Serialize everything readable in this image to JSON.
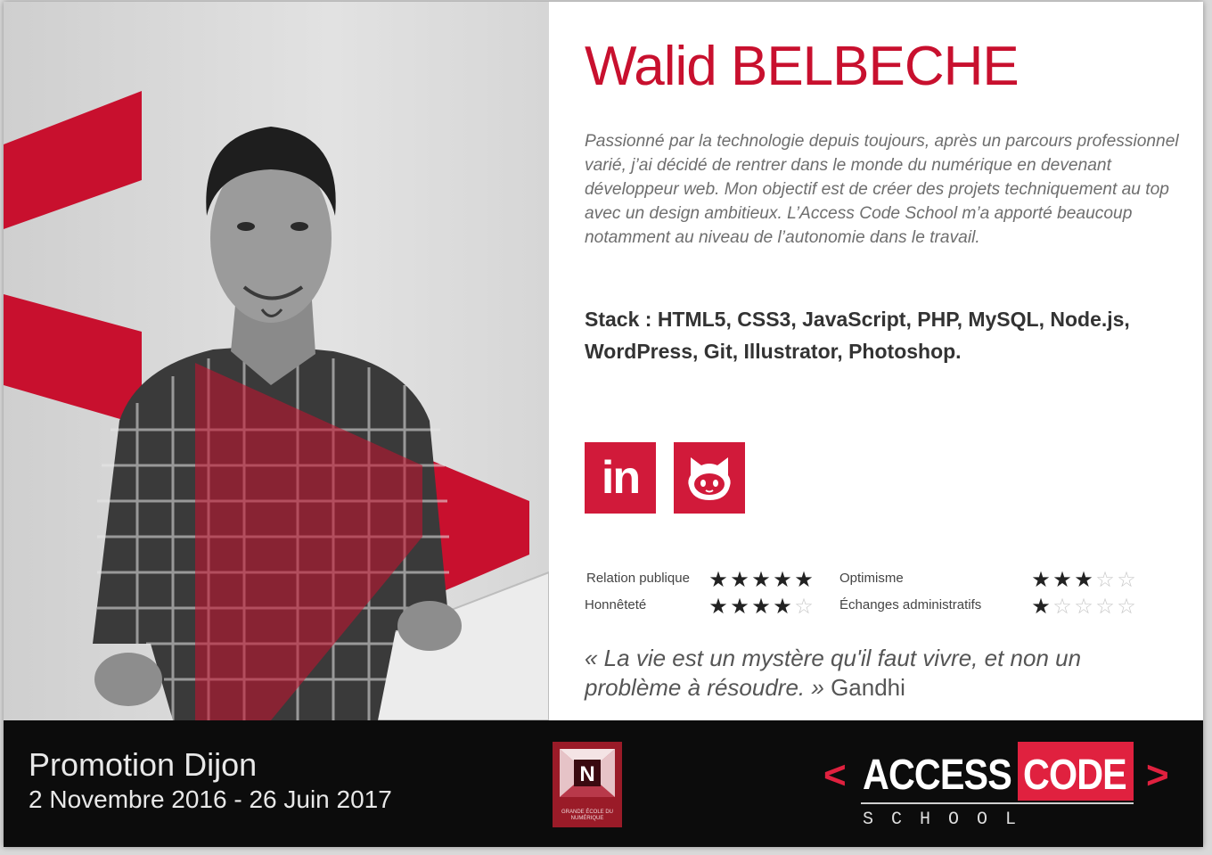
{
  "profile": {
    "first_name": "Walid",
    "last_name": "BELBECHE",
    "bio": "Passionné par la technologie depuis toujours, après un parcours professionnel varié, j’ai décidé de rentrer dans le monde du numérique en devenant développeur web. Mon objectif est de créer des projets techniquement au top avec un design ambitieux. L’Access Code School m’a apporté beaucoup notamment au niveau de l’autonomie dans le travail.",
    "stack": "Stack : HTML5, CSS3, JavaScript, PHP, MySQL, Node.js, WordPress, Git, Illustrator, Photoshop."
  },
  "social": {
    "linkedin_icon": "linkedin-icon",
    "linkedin_label": "in",
    "github_icon": "github-octocat-icon"
  },
  "skills": [
    {
      "label": "Relation publique",
      "rating": 5,
      "max": 5
    },
    {
      "label": "Honnêteté",
      "rating": 4,
      "max": 5
    },
    {
      "label": "Optimisme",
      "rating": 3,
      "max": 5
    },
    {
      "label": "Échanges administratifs",
      "rating": 1,
      "max": 5
    }
  ],
  "quote": {
    "text": "« La vie est un mystère qu'il faut vivre, et non un problème à résoudre. »",
    "author": "Gandhi"
  },
  "footer": {
    "promotion": "Promotion Dijon",
    "dates": "2 Novembre 2016 - 26 Juin 2017",
    "badge_text": "GRANDE ÉCOLE DU NUMÉRIQUE",
    "logo": {
      "open_chevron": "<",
      "word1": "ACCESS",
      "word2": "CODE",
      "close_chevron": ">",
      "tagline": "SCHOOL"
    }
  },
  "colors": {
    "accent": "#d11a3a",
    "footer_bg": "#0c0c0c",
    "text": "#333333"
  }
}
